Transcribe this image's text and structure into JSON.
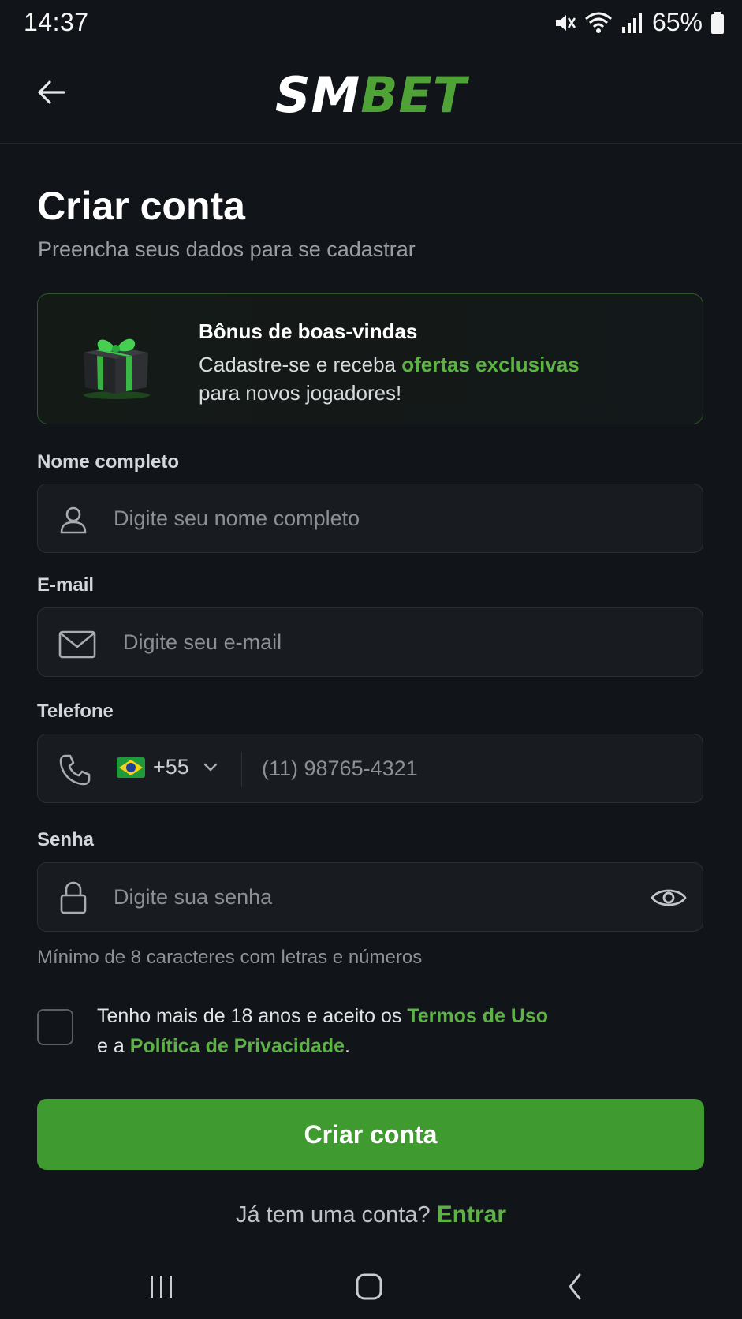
{
  "status_bar": {
    "time": "14:37",
    "battery": "65%"
  },
  "header": {
    "logo_part1": "SM",
    "logo_part2": "BET"
  },
  "page": {
    "title": "Criar conta",
    "subtitle": "Preencha seus dados para se cadastrar"
  },
  "bonus": {
    "title": "Bônus de boas-vindas",
    "line1_prefix": "Cadastre-se e receba ",
    "line1_highlight": "ofertas exclusivas",
    "line2": "para novos jogadores!"
  },
  "form": {
    "name": {
      "label": "Nome completo",
      "placeholder": "Digite seu nome completo"
    },
    "email": {
      "label": "E-mail",
      "placeholder": "Digite seu e-mail"
    },
    "phone": {
      "label": "Telefone",
      "country_code": "+55",
      "placeholder": "(11) 98765-4321"
    },
    "password": {
      "label": "Senha",
      "placeholder": "Digite sua senha",
      "hint": "Mínimo de 8 caracteres com letras e números"
    },
    "terms": {
      "prefix": "Tenho mais de 18 anos e aceito os ",
      "terms_link": "Termos de Uso",
      "middle": "e a ",
      "privacy_link": "Política de Privacidade",
      "suffix": "."
    },
    "submit_label": "Criar conta"
  },
  "footer": {
    "question": "Já tem uma conta? ",
    "login_link": "Entrar"
  },
  "colors": {
    "accent": "#3f9a2f",
    "link": "#5cb343",
    "background": "#111419"
  },
  "icons": [
    "back-arrow-icon",
    "gift-icon",
    "user-icon",
    "mail-icon",
    "phone-icon",
    "brazil-flag-icon",
    "chevron-down-icon",
    "lock-icon",
    "eye-icon",
    "recent-apps-icon",
    "home-icon",
    "nav-back-icon"
  ]
}
